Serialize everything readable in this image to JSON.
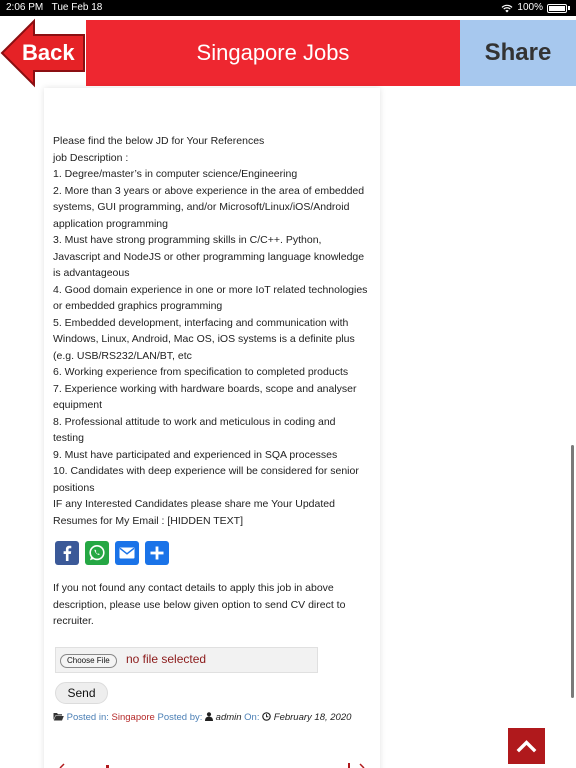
{
  "status_bar": {
    "time": "2:06 PM",
    "date": "Tue Feb 18",
    "battery": "100%"
  },
  "header": {
    "back_label": "Back",
    "title": "Singapore Jobs",
    "share_label": "Share",
    "title_bg": "#ee2730",
    "share_bg": "#a7c8ee"
  },
  "job_description": {
    "lines": [
      "Please find the below JD for Your References",
      "job Description :",
      "1. Degree/master’s in computer science/Engineering",
      "2. More than 3 years or above experience in the area of embedded",
      "systems, GUI programming, and/or Microsoft/Linux/iOS/Android",
      "application programming",
      "3. Must have strong programming skills in C/C++. Python,",
      "Javascript and NodeJS or other programming language knowledge",
      "is advantageous",
      "4. Good domain experience in one or more IoT related technologies",
      "or embedded graphics programming",
      "5. Embedded development, interfacing and communication with",
      "Windows, Linux, Android, Mac OS, iOS systems is a definite plus",
      "(e.g. USB/RS232/LAN/BT, etc",
      "6. Working experience from specification to completed products",
      "7. Experience working with hardware boards, scope and analyser",
      "equipment",
      "8. Professional attitude to work and meticulous in coding and",
      "testing",
      "9. Must have participated and experienced in SQA processes",
      "10. Candidates with deep experience will be considered for senior",
      "positions",
      "IF any Interested Candidates please share me Your Updated",
      "Resumes for My Email : [HIDDEN TEXT]"
    ]
  },
  "social": {
    "icons": [
      "facebook-icon",
      "whatsapp-icon",
      "email-icon",
      "share-plus-icon"
    ]
  },
  "note": {
    "lines": [
      "If you not found any contact details to apply this job in above",
      "description, please use below given option to send CV direct to",
      "recruiter."
    ]
  },
  "upload": {
    "choose_label": "Choose File",
    "status": "no file selected"
  },
  "send_label": "Send",
  "meta": {
    "posted_in_label": "Posted in:",
    "category": "Singapore",
    "posted_by_label": "Posted by:",
    "author": "admin",
    "on_label": "On:",
    "date": "February 18, 2020"
  }
}
